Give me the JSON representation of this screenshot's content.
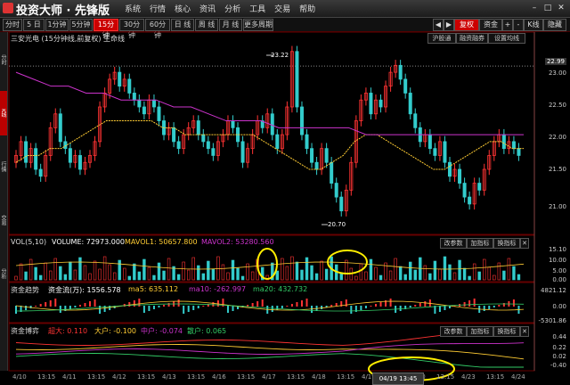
{
  "app": {
    "title": "投资大师 · 先锋版"
  },
  "menu": [
    "系统",
    "行情",
    "核心",
    "资讯",
    "分析",
    "工具",
    "交易",
    "帮助"
  ],
  "periods": [
    "分时",
    "5 日",
    "1分钟",
    "5分钟",
    "15分钟",
    "30分钟",
    "60分钟",
    "日 线",
    "周 线",
    "月 线",
    "更多周期"
  ],
  "active_period": "15分钟",
  "toolbar_right": {
    "restore": "复权",
    "money": "资金",
    "zoom_in": "+",
    "zoom_out": "-",
    "k": "K线",
    "hide": "隐藏"
  },
  "sidebar_tabs": [
    "分时",
    "K线",
    "行情",
    "交易",
    "分析"
  ],
  "chart_header": {
    "stock": "三安光电 (15分钟线,前复权) 主命线",
    "btn1": "沪股通",
    "btn2": "融资融券",
    "btn3": "设置均线"
  },
  "price_labels": [
    "23.00",
    "22.50",
    "22.00",
    "21.50",
    "21.00"
  ],
  "current_price": "22.99",
  "annotations": {
    "high": "23.22",
    "low": "20.70"
  },
  "vol_panel": {
    "label": "VOL(5,10)",
    "volume": "VOLUME: 72973.000",
    "mavol1": "MAVOL1: 50657.800",
    "mavol2": "MAVOL2: 53280.560",
    "btns": [
      "改参数",
      "加指标",
      "换指标"
    ],
    "scale": [
      "15.10",
      "10.00",
      "5.00",
      "0.00"
    ]
  },
  "flow_panel": {
    "label": "资金趋势",
    "main": "资金流(万): 1556.578",
    "ma5": "ma5: 635.112",
    "ma10": "ma10: -262.997",
    "ma20": "ma20: 432.732",
    "scale": [
      "4821.12",
      "0.00",
      "-5301.86"
    ]
  },
  "game_panel": {
    "label": "资金博弈",
    "super": "超大: 0.110",
    "big": "大户: -0.100",
    "mid": "中户: -0.074",
    "small": "散户: 0.065",
    "scale": [
      "0.44",
      "0.22",
      "0.02",
      "-0.40"
    ]
  },
  "dates": [
    "4/10",
    "13:15",
    "4/11",
    "13:15",
    "4/12",
    "13:15",
    "4/13",
    "13:15",
    "4/16",
    "13:15",
    "4/17",
    "13:15",
    "4/18",
    "13:15",
    "4/19",
    "13:15",
    "4/20",
    "13:15",
    "4/23",
    "13:15",
    "4/24"
  ],
  "cursor_date": "04/19 13:45",
  "colors": {
    "up": "#ff3333",
    "down": "#33cccc",
    "ma1": "#ffcc33",
    "ma2": "#cc33cc",
    "highlight": "#ffee00"
  },
  "chart_data": {
    "type": "candlestick",
    "y_range": [
      20.6,
      23.3
    ],
    "close": [
      21.7,
      21.9,
      21.6,
      21.8,
      21.5,
      21.4,
      21.7,
      22.1,
      22.3,
      21.9,
      21.8,
      21.6,
      21.7,
      21.5,
      21.6,
      21.7,
      21.9,
      22.4,
      22.6,
      22.8,
      22.9,
      22.7,
      22.8,
      22.6,
      22.5,
      22.4,
      22.3,
      22.5,
      22.4,
      22.2,
      22.0,
      22.1,
      21.9,
      21.8,
      22.0,
      22.1,
      22.2,
      22.0,
      21.9,
      21.8,
      21.7,
      21.9,
      22.0,
      22.2,
      22.1,
      21.9,
      21.6,
      21.8,
      22.0,
      22.2,
      22.1,
      22.3,
      22.0,
      21.8,
      22.0,
      22.4,
      23.2,
      22.4,
      22.0,
      21.8,
      21.6,
      21.5,
      21.8,
      21.6,
      21.3,
      21.1,
      20.9,
      21.2,
      21.6,
      22.2,
      22.5,
      22.6,
      22.3,
      22.5,
      22.4,
      22.7,
      22.9,
      23.0,
      22.8,
      22.6,
      22.3,
      22.1,
      21.9,
      22.0,
      21.8,
      21.7,
      21.9,
      21.6,
      21.4,
      21.5,
      21.3,
      21.1,
      21.0,
      21.3,
      21.2,
      21.5,
      21.7,
      21.9,
      22.0,
      21.8,
      21.9,
      21.8,
      21.7
    ],
    "ma1": [
      21.6,
      21.7,
      21.7,
      21.8,
      21.8,
      21.9,
      22.0,
      22.1,
      22.2,
      22.2,
      22.2,
      22.2,
      22.2,
      22.1,
      22.1,
      22.0,
      22.0,
      22.0,
      22.0,
      22.0,
      22.0,
      22.0,
      21.9,
      21.8,
      21.7,
      21.6,
      21.5,
      21.5,
      21.6,
      21.7,
      21.9,
      22.0,
      22.0,
      21.9,
      21.8,
      21.7,
      21.6,
      21.5,
      21.5,
      21.6,
      21.7,
      21.8,
      21.9,
      21.9,
      21.8,
      21.8
    ],
    "ma2": [
      22.9,
      22.8,
      22.7,
      22.7,
      22.6,
      22.6,
      22.5,
      22.5,
      22.5,
      22.4,
      22.4,
      22.3,
      22.2,
      22.2,
      22.2,
      22.1,
      22.1,
      22.1,
      22.1,
      22.1,
      22.0,
      22.0,
      22.0,
      22.0,
      22.0,
      22.0,
      22.0,
      22.0,
      22.0,
      22.0
    ]
  }
}
